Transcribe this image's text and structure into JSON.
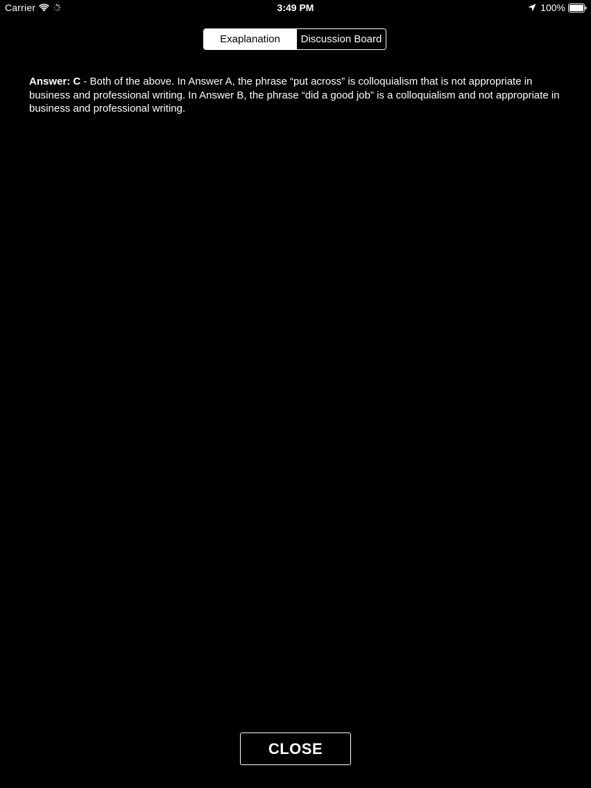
{
  "status_bar": {
    "carrier": "Carrier",
    "time": "3:49 PM",
    "battery_percent": "100%",
    "icons": [
      "wifi-icon",
      "activity-spinner-icon",
      "location-arrow-icon",
      "battery-icon"
    ]
  },
  "segmented_control": {
    "segments": [
      {
        "label": "Exaplanation",
        "selected": true
      },
      {
        "label": "Discussion Board",
        "selected": false
      }
    ]
  },
  "explanation": {
    "answer_label": "Answer:",
    "answer_choice": "C",
    "text": " - Both of the above. In Answer A, the phrase “put across” is colloquialism that is not appropriate in business and professional writing. In Answer B, the phrase “did a good job” is a colloquialism and not appropriate in business and professional writing."
  },
  "close_button": {
    "label": "CLOSE"
  },
  "colors": {
    "background": "#000000",
    "foreground": "#ffffff"
  }
}
